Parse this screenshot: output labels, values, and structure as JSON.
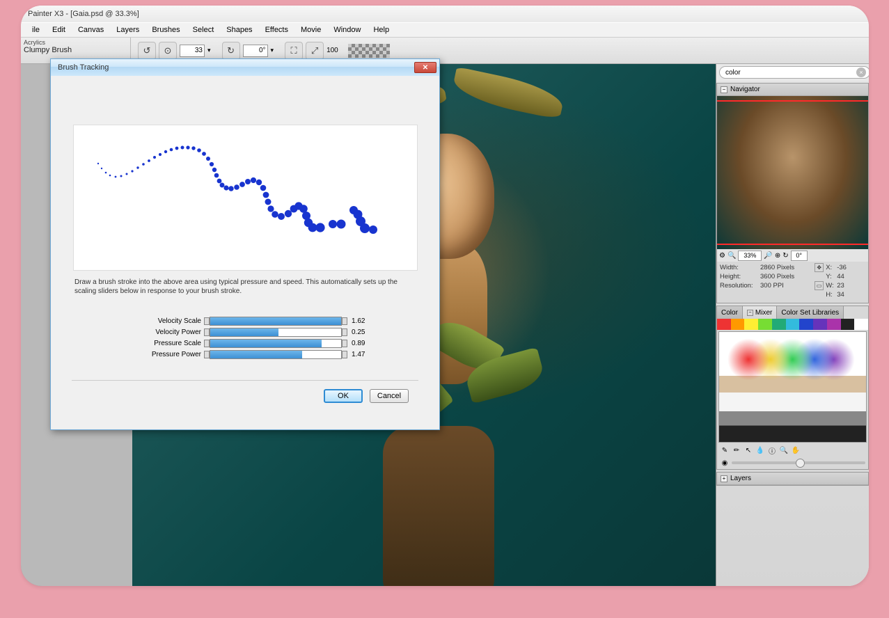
{
  "titleBar": "Painter X3 - [Gaia.psd @ 33.3%]",
  "menu": [
    "ile",
    "Edit",
    "Canvas",
    "Layers",
    "Brushes",
    "Select",
    "Shapes",
    "Effects",
    "Movie",
    "Window",
    "Help"
  ],
  "brushCategory": "Acrylics",
  "brushName": "Clumpy Brush",
  "toolbar": {
    "size": "33",
    "angle": "0°",
    "opacity": "100"
  },
  "dialog": {
    "title": "Brush Tracking",
    "help": "Draw a brush stroke into the above area using typical pressure and speed.  This automatically sets up the scaling sliders below in response to your brush stroke.",
    "sliders": [
      {
        "label": "Velocity Scale",
        "value": "1.62",
        "fill": 100
      },
      {
        "label": "Velocity Power",
        "value": "0.25",
        "fill": 52
      },
      {
        "label": "Pressure Scale",
        "value": "0.89",
        "fill": 85
      },
      {
        "label": "Pressure Power",
        "value": "1.47",
        "fill": 70
      }
    ],
    "ok": "OK",
    "cancel": "Cancel"
  },
  "search": {
    "placeholder": "color"
  },
  "navigator": {
    "title": "Navigator",
    "zoom": "33%",
    "rotate": "0°",
    "width": "2860 Pixels",
    "height": "3600 Pixels",
    "resolution": "300 PPI",
    "x": "-36",
    "y": "44",
    "w": "23",
    "h": "34",
    "lblWidth": "Width:",
    "lblHeight": "Height:",
    "lblRes": "Resolution:",
    "lX": "X:",
    "lY": "Y:",
    "lW": "W:",
    "lH": "H:"
  },
  "colorTabs": [
    "Color",
    "Mixer",
    "Color Set Libraries"
  ],
  "swatchColors": [
    "#e33",
    "#f90",
    "#fe3",
    "#7d3",
    "#2a7",
    "#3bd",
    "#24c",
    "#63b",
    "#a3a",
    "#222",
    "#fff"
  ],
  "layersTitle": "Layers"
}
